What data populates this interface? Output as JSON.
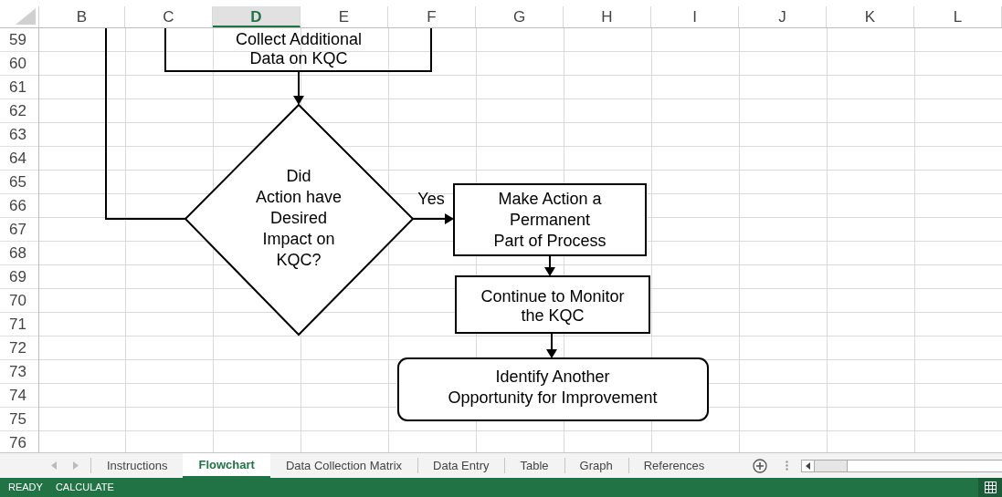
{
  "columns": [
    {
      "label": "B",
      "selected": false
    },
    {
      "label": "C",
      "selected": false
    },
    {
      "label": "D",
      "selected": true
    },
    {
      "label": "E",
      "selected": false
    },
    {
      "label": "F",
      "selected": false
    },
    {
      "label": "G",
      "selected": false
    },
    {
      "label": "H",
      "selected": false
    },
    {
      "label": "I",
      "selected": false
    },
    {
      "label": "J",
      "selected": false
    },
    {
      "label": "K",
      "selected": false
    },
    {
      "label": "L",
      "selected": false
    }
  ],
  "rows": [
    "59",
    "60",
    "61",
    "62",
    "63",
    "64",
    "65",
    "66",
    "67",
    "68",
    "69",
    "70",
    "71",
    "72",
    "73",
    "74",
    "75",
    "76"
  ],
  "flowchart": {
    "nodes": [
      {
        "kind": "process-cut",
        "lines": [
          "Collect Additional",
          "Data on KQC"
        ]
      },
      {
        "kind": "decision",
        "lines": [
          "Did",
          "Action have",
          "Desired",
          "Impact on",
          "KQC?"
        ]
      },
      {
        "kind": "process",
        "lines": [
          "Make Action a",
          "Permanent",
          "Part of Process"
        ]
      },
      {
        "kind": "process",
        "lines": [
          "Continue to Monitor",
          "the KQC"
        ]
      },
      {
        "kind": "terminal",
        "lines": [
          "Identify Another",
          "Opportunity for Improvement"
        ]
      }
    ],
    "branch_label": "Yes"
  },
  "sheet_tabs": [
    {
      "label": "Instructions",
      "selected": false
    },
    {
      "label": "Flowchart",
      "selected": true
    },
    {
      "label": "Data Collection Matrix",
      "selected": false
    },
    {
      "label": "Data Entry",
      "selected": false
    },
    {
      "label": "Table",
      "selected": false
    },
    {
      "label": "Graph",
      "selected": false
    },
    {
      "label": "References",
      "selected": false
    }
  ],
  "status_bar": [
    "READY",
    "CALCULATE"
  ]
}
